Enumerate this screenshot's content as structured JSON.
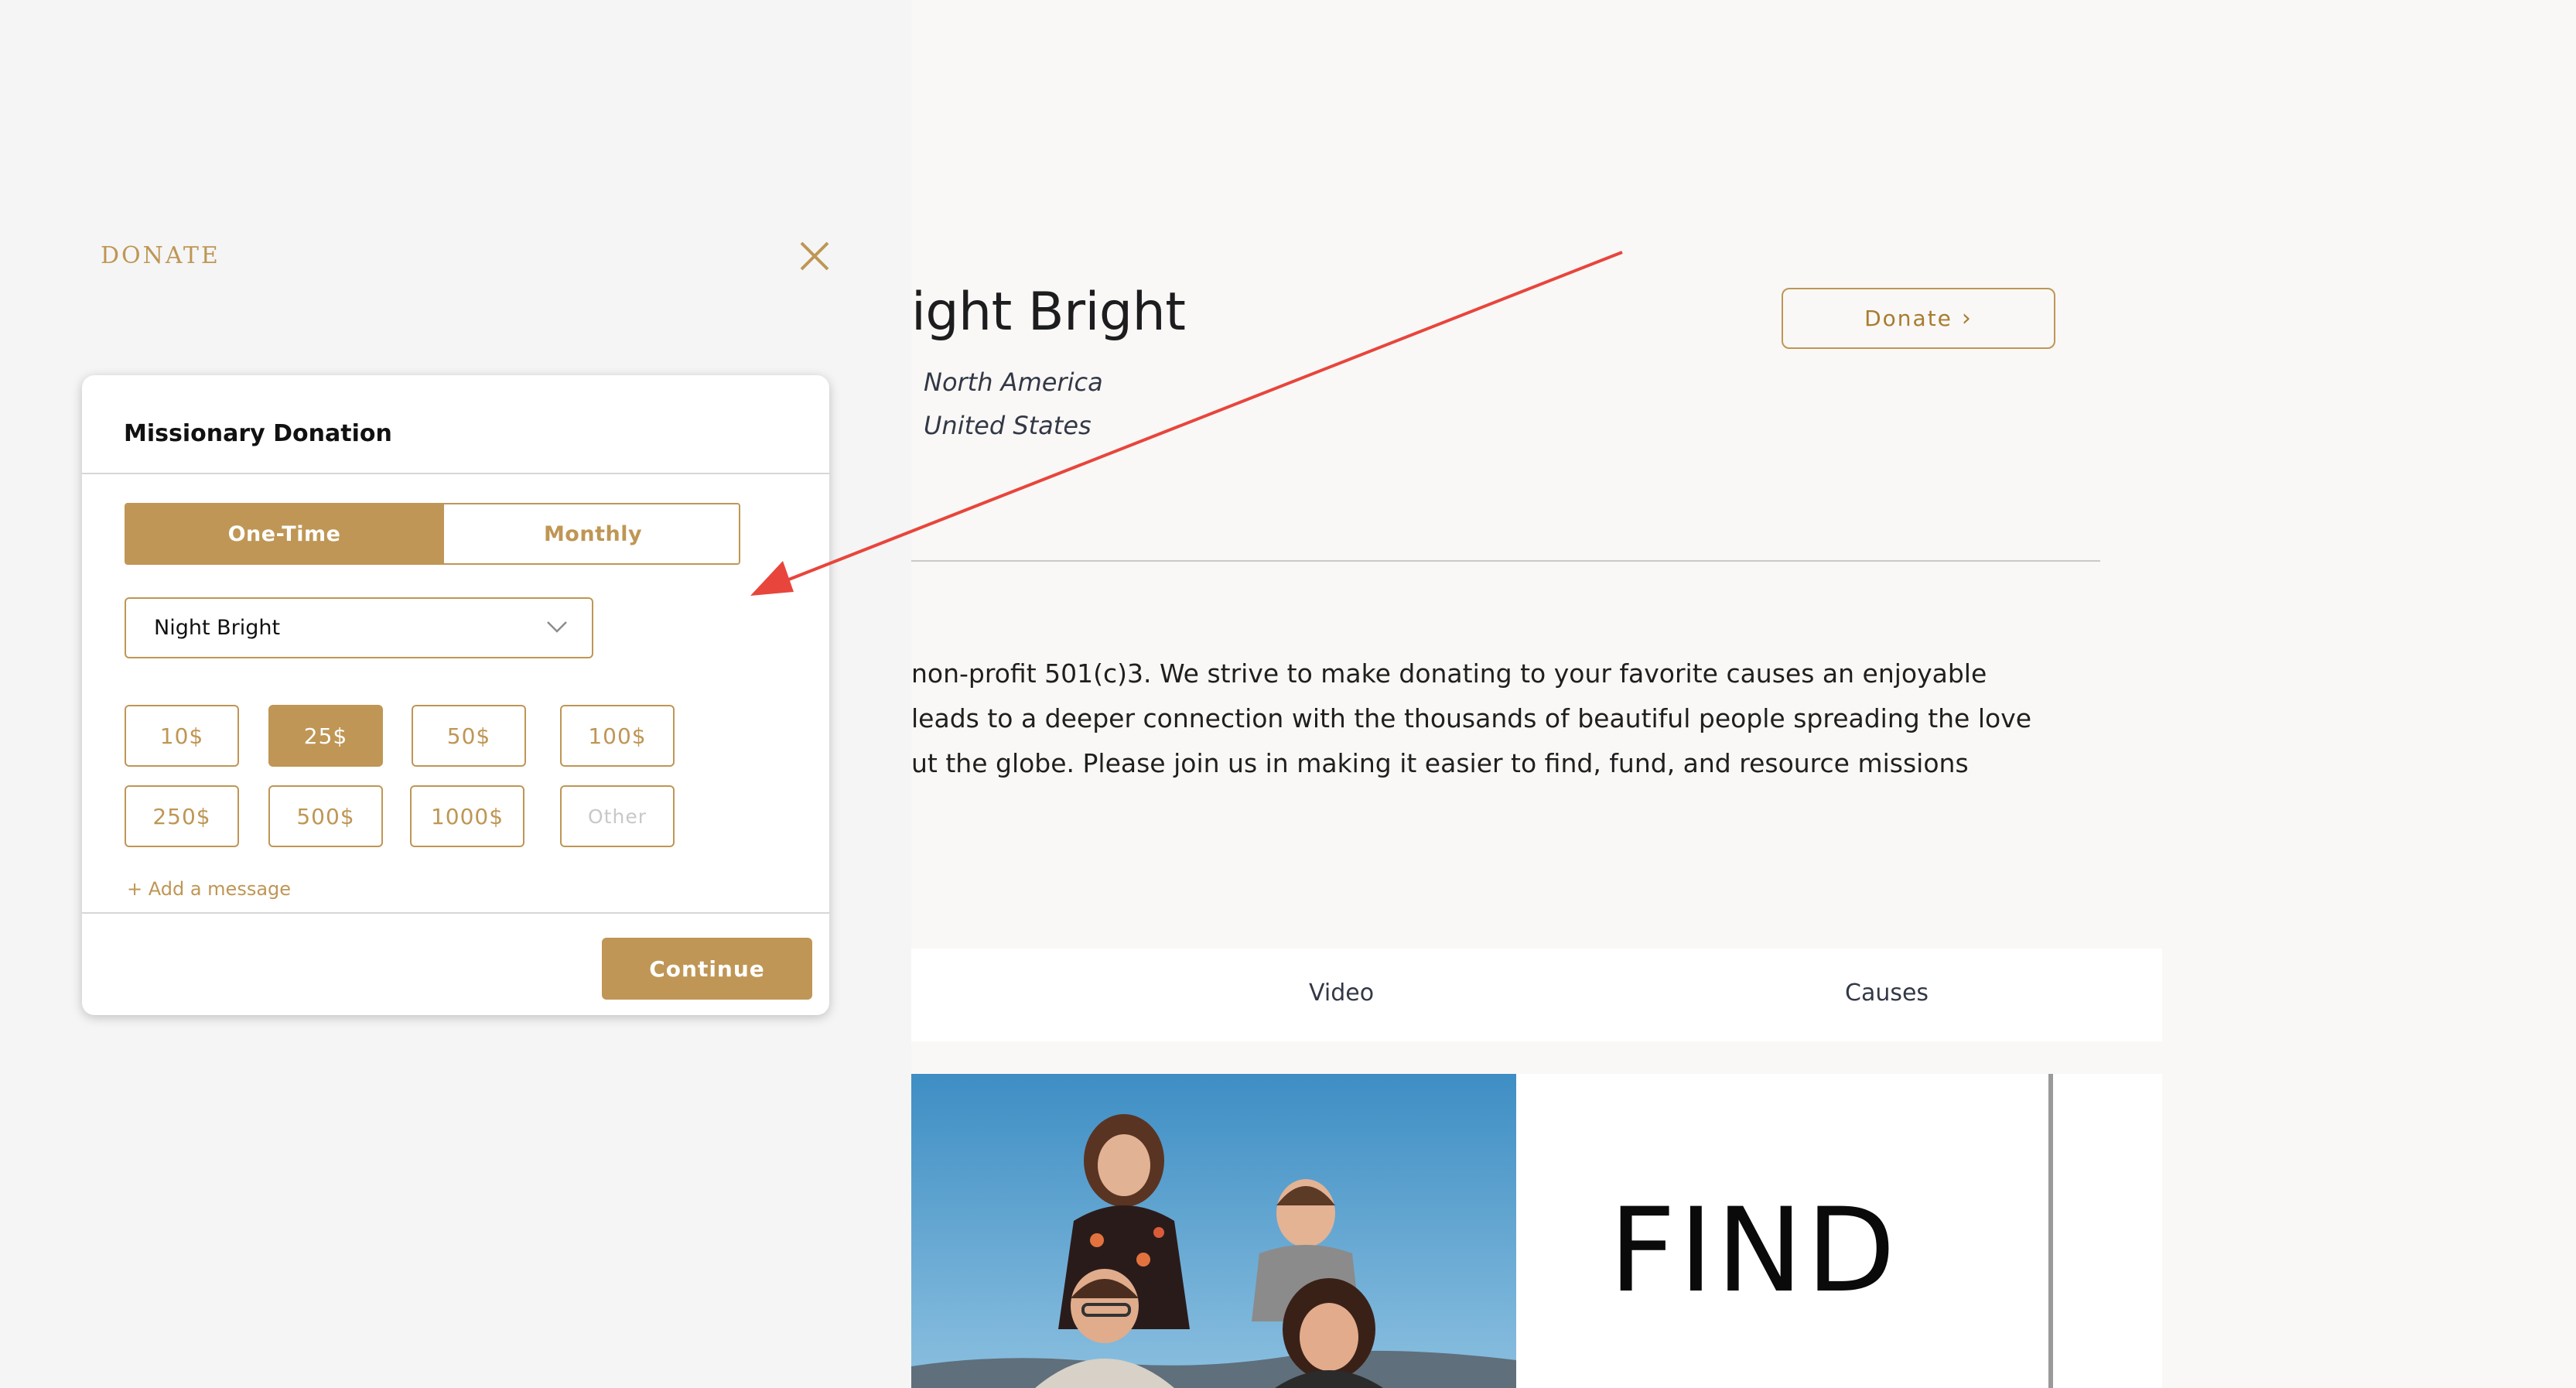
{
  "background_page": {
    "profile_name": "ight Bright",
    "region": "North America",
    "country": "United States",
    "donate_button_label": "Donate",
    "about_lines": [
      "non-profit 501(c)3. We strive to make donating to your favorite causes an enjoyable",
      "leads to a deeper connection with the thousands of beautiful people spreading the love",
      "ut the globe. Please join us in making it easier to find, fund, and resource missions"
    ],
    "tabs": [
      {
        "label": "Video"
      },
      {
        "label": "Causes"
      }
    ],
    "find_heading": "FIND"
  },
  "drawer": {
    "title": "DONATE",
    "close_icon": "close-icon"
  },
  "donation_card": {
    "title": "Missionary Donation",
    "frequency": {
      "options": [
        "One-Time",
        "Monthly"
      ],
      "selected": "One-Time"
    },
    "recipient_select": {
      "value": "Night Bright",
      "icon": "chevron-down-icon"
    },
    "amounts": [
      {
        "label": "10$",
        "selected": false
      },
      {
        "label": "25$",
        "selected": true
      },
      {
        "label": "50$",
        "selected": false
      },
      {
        "label": "100$",
        "selected": false
      },
      {
        "label": "250$",
        "selected": false
      },
      {
        "label": "500$",
        "selected": false
      },
      {
        "label": "1000$",
        "selected": false
      }
    ],
    "other_placeholder": "Other",
    "add_message_label": "+ Add a message",
    "continue_label": "Continue"
  },
  "colors": {
    "accent": "#bf9655",
    "annotation_arrow": "#e8453c",
    "drawer_background": "#f5f5f5",
    "page_background": "#f9f8f6"
  }
}
